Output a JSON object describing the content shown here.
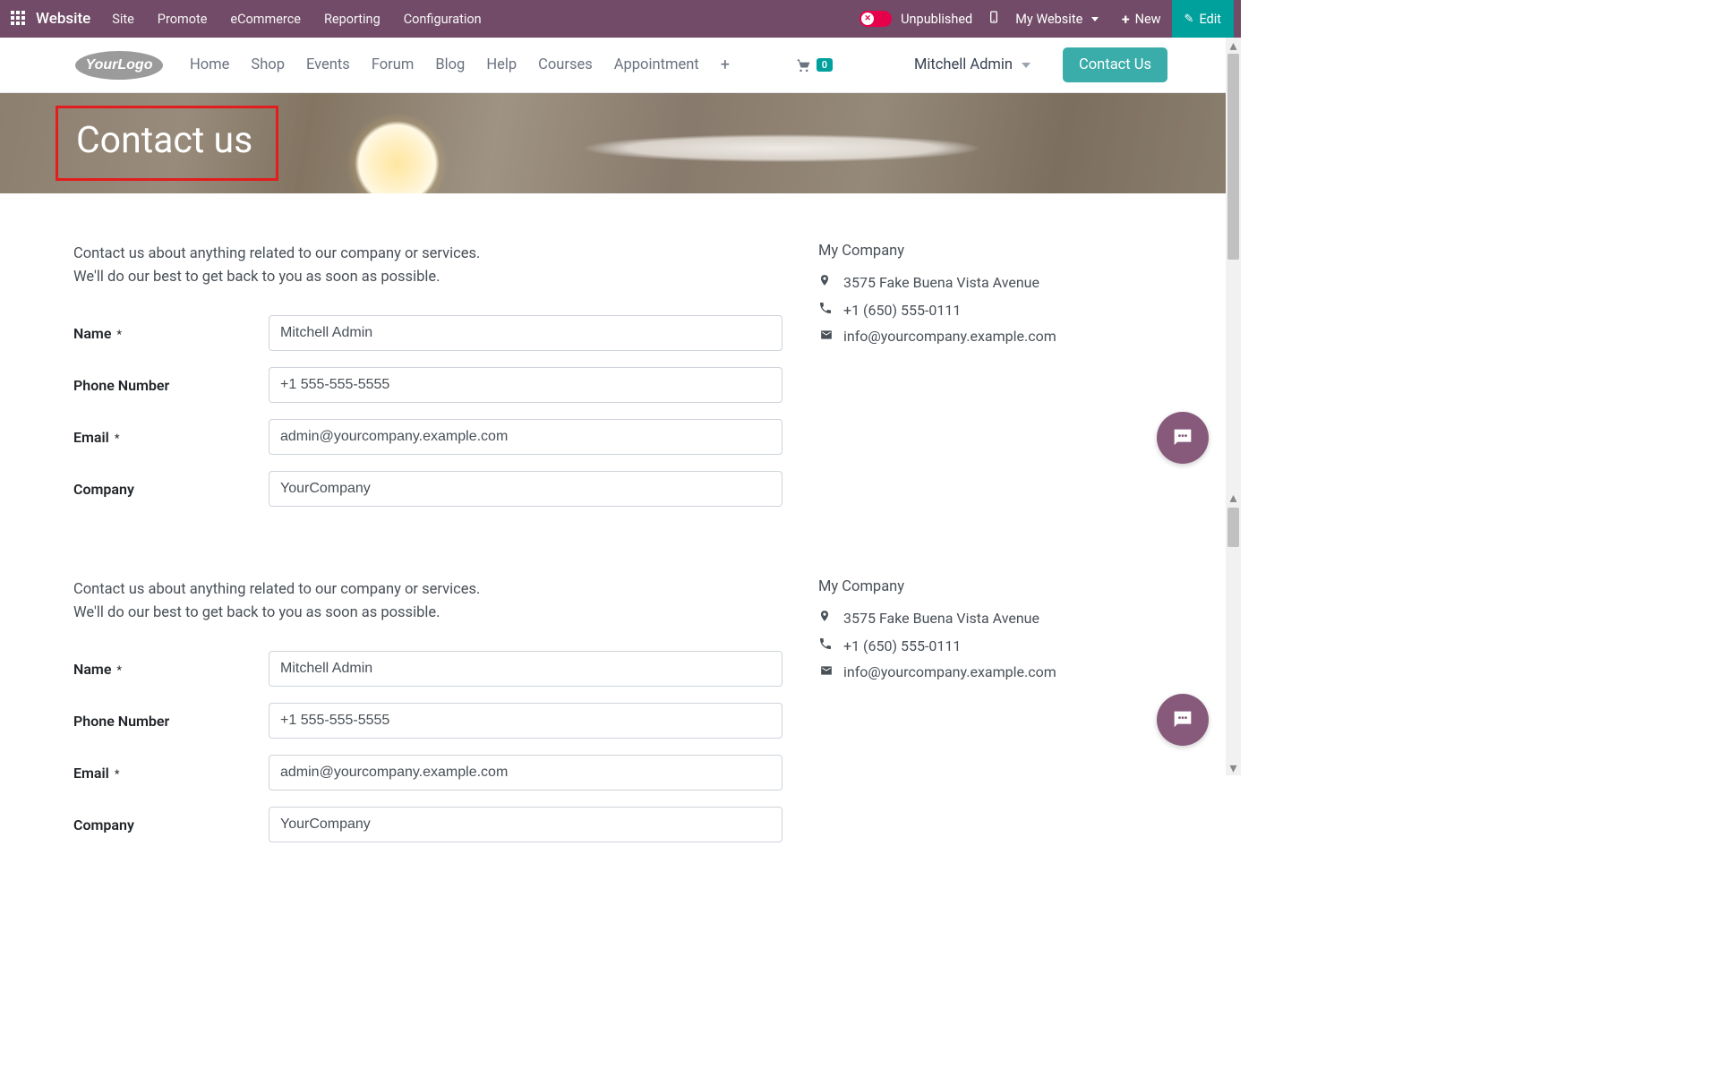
{
  "admin": {
    "brand": "Website",
    "menu": [
      "Site",
      "Promote",
      "eCommerce",
      "Reporting",
      "Configuration"
    ],
    "status": "Unpublished",
    "mySite": "My Website",
    "newLabel": "New",
    "editLabel": "Edit"
  },
  "siteNav": {
    "links": [
      "Home",
      "Shop",
      "Events",
      "Forum",
      "Blog",
      "Help",
      "Courses",
      "Appointment"
    ],
    "cartCount": "0",
    "userName": "Mitchell Admin",
    "contactBtn": "Contact Us"
  },
  "hero": {
    "title": "Contact us"
  },
  "form": {
    "introLine1": "Contact us about anything related to our company or services.",
    "introLine2": "We'll do our best to get back to you as soon as possible.",
    "labels": {
      "name": "Name",
      "phone": "Phone Number",
      "email": "Email",
      "company": "Company",
      "required": "*"
    },
    "values": {
      "name": "Mitchell Admin",
      "phone": "+1 555-555-5555",
      "email": "admin@yourcompany.example.com",
      "company": "YourCompany"
    }
  },
  "companyInfo": {
    "name": "My Company",
    "address": "3575 Fake Buena Vista Avenue",
    "phone": "+1 (650) 555-0111",
    "email": "info@yourcompany.example.com"
  }
}
